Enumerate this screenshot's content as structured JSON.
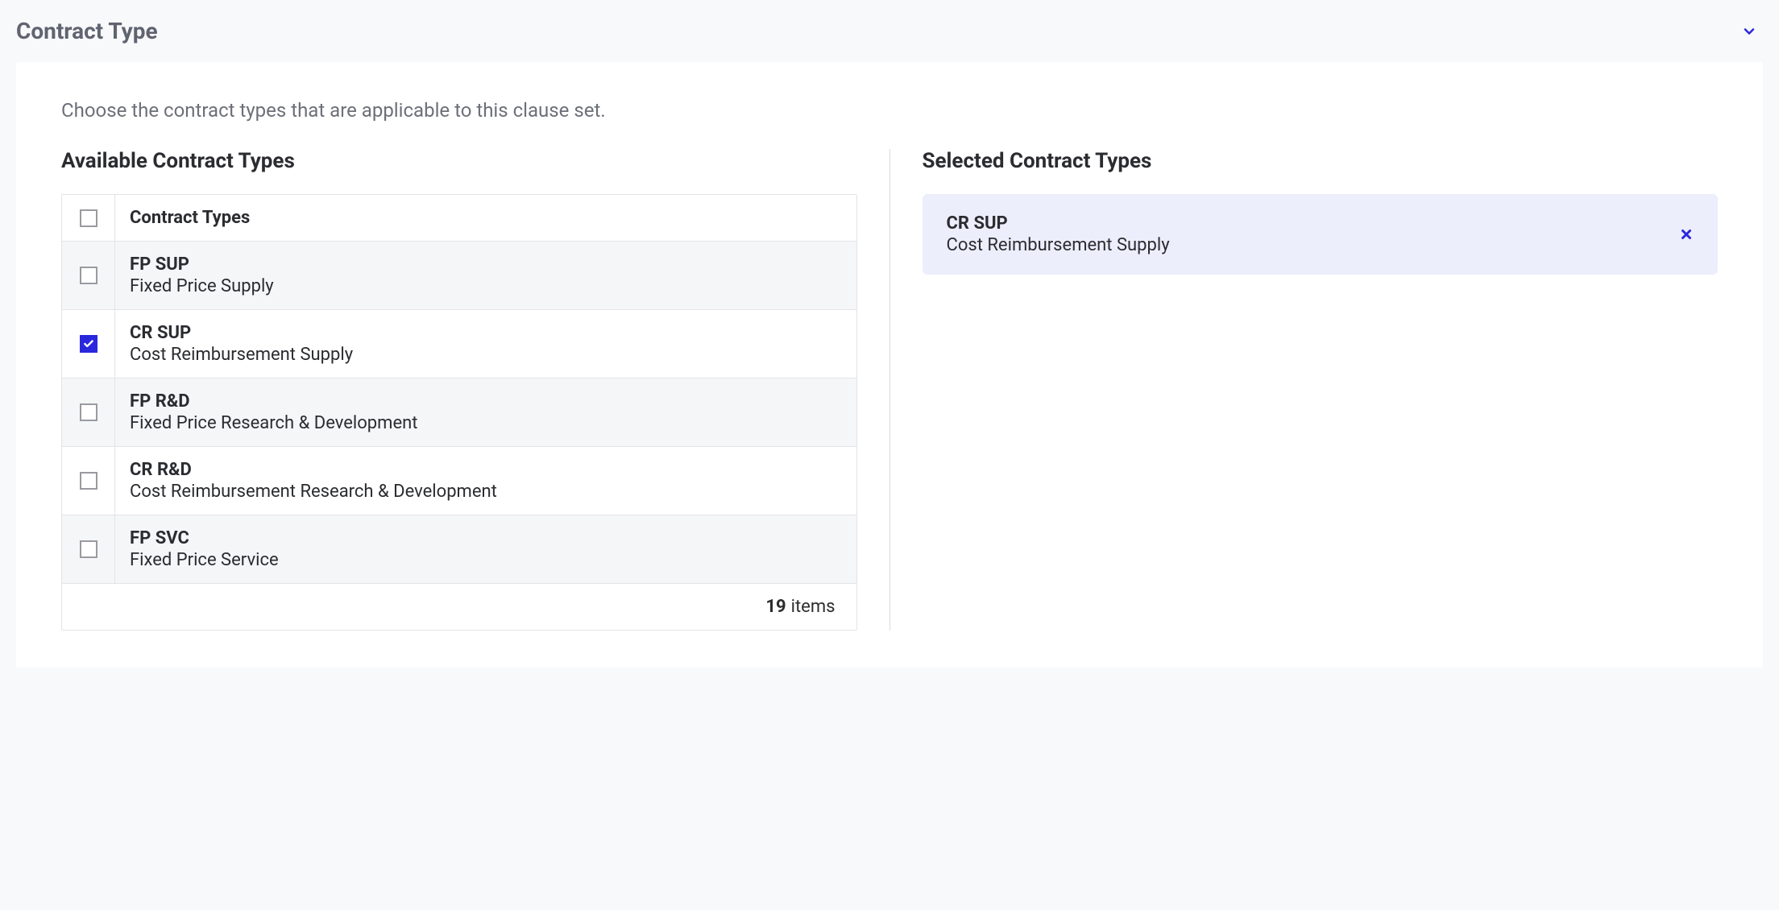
{
  "section": {
    "title": "Contract Type"
  },
  "helper_text": "Choose the contract types that are applicable to this clause set.",
  "available": {
    "heading": "Available Contract Types",
    "column_header": "Contract Types",
    "items": [
      {
        "code": "FP SUP",
        "desc": "Fixed Price Supply",
        "checked": false
      },
      {
        "code": "CR SUP",
        "desc": "Cost Reimbursement Supply",
        "checked": true
      },
      {
        "code": "FP R&D",
        "desc": "Fixed Price Research & Development",
        "checked": false
      },
      {
        "code": "CR R&D",
        "desc": "Cost Reimbursement Research & Development",
        "checked": false
      },
      {
        "code": "FP SVC",
        "desc": "Fixed Price Service",
        "checked": false
      }
    ],
    "total_count": "19",
    "total_label": "items"
  },
  "selected": {
    "heading": "Selected Contract Types",
    "items": [
      {
        "code": "CR SUP",
        "desc": "Cost Reimbursement Supply"
      }
    ]
  }
}
